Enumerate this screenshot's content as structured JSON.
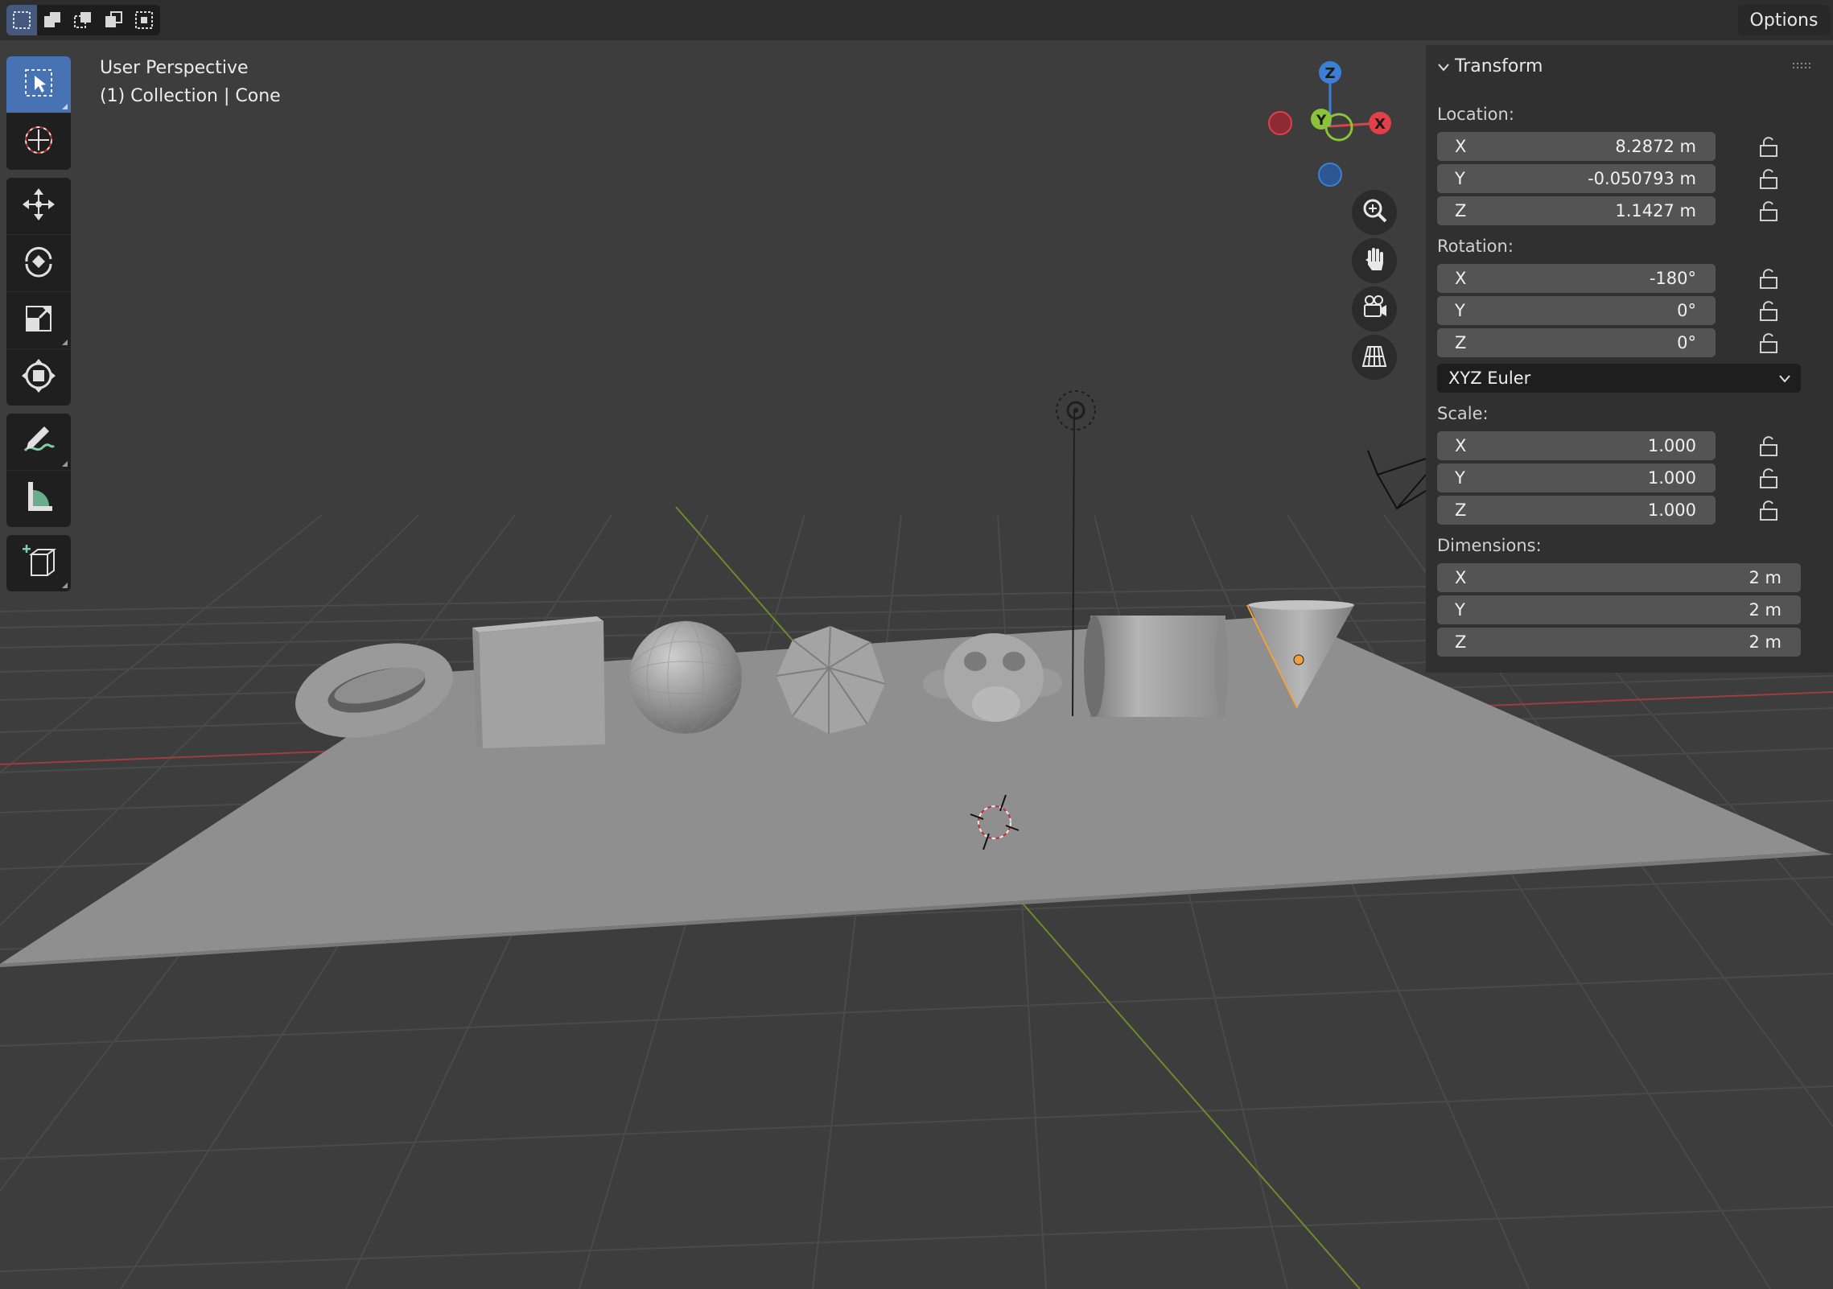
{
  "header": {
    "options_label": "Options",
    "select_modes": [
      "select-box-new-icon",
      "select-box-extend-icon",
      "select-box-subtract-icon",
      "select-box-difference-icon",
      "select-box-intersect-icon"
    ]
  },
  "viewport": {
    "view_name": "User Perspective",
    "collection_label": "(1) Collection | Cone"
  },
  "toolbar": {
    "groups": [
      [
        "select-box-icon",
        "cursor-icon"
      ],
      [
        "move-icon",
        "rotate-icon",
        "scale-icon",
        "transform-icon"
      ],
      [
        "annotate-icon",
        "measure-icon"
      ],
      [
        "add-cube-icon"
      ]
    ],
    "active_tool": "select-box-icon"
  },
  "gizmo": {
    "axes": {
      "x": "X",
      "y": "Y",
      "z": "Z"
    },
    "colors": {
      "x": "#e0404a",
      "y": "#8ac23a",
      "z": "#3b7fd6"
    },
    "buttons": [
      "zoom-icon",
      "hand-pan-icon",
      "camera-view-icon",
      "ortho-grid-icon"
    ]
  },
  "npanel": {
    "title": "Transform",
    "location": {
      "label": "Location:",
      "x": {
        "axis": "X",
        "value": "8.2872 m"
      },
      "y": {
        "axis": "Y",
        "value": "-0.050793 m"
      },
      "z": {
        "axis": "Z",
        "value": "1.1427 m"
      }
    },
    "rotation": {
      "label": "Rotation:",
      "x": {
        "axis": "X",
        "value": "-180°"
      },
      "y": {
        "axis": "Y",
        "value": "0°"
      },
      "z": {
        "axis": "Z",
        "value": "0°"
      }
    },
    "rotation_mode": "XYZ Euler",
    "scale": {
      "label": "Scale:",
      "x": {
        "axis": "X",
        "value": "1.000"
      },
      "y": {
        "axis": "Y",
        "value": "1.000"
      },
      "z": {
        "axis": "Z",
        "value": "1.000"
      }
    },
    "dimensions": {
      "label": "Dimensions:",
      "x": {
        "axis": "X",
        "value": "2 m"
      },
      "y": {
        "axis": "Y",
        "value": "2 m"
      },
      "z": {
        "axis": "Z",
        "value": "2 m"
      }
    }
  },
  "scene": {
    "objects": [
      "Torus",
      "Cube",
      "UV Sphere",
      "Ico Sphere",
      "Suzanne",
      "Light",
      "Cylinder",
      "Cone",
      "Plane",
      "Camera"
    ],
    "selected_object": "Cone",
    "colors": {
      "background": "#3d3d3d",
      "plane": "#8f8f8f",
      "object": "#a7a7a7",
      "x_axis": "#a03c3c",
      "y_axis": "#6d8a2e",
      "selection": "#f2a23a"
    }
  }
}
